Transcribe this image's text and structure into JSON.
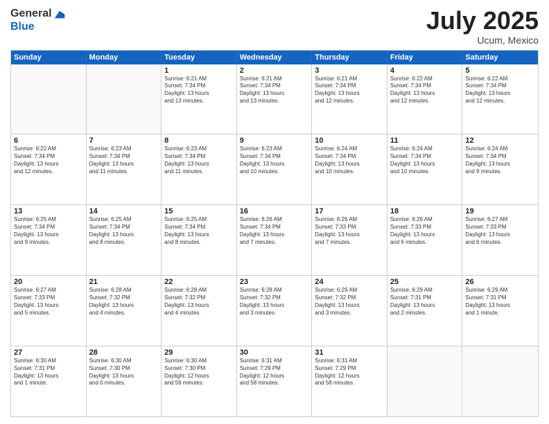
{
  "logo": {
    "general": "General",
    "blue": "Blue"
  },
  "title": "July 2025",
  "location": "Ucum, Mexico",
  "header_days": [
    "Sunday",
    "Monday",
    "Tuesday",
    "Wednesday",
    "Thursday",
    "Friday",
    "Saturday"
  ],
  "weeks": [
    [
      {
        "day": "",
        "text": ""
      },
      {
        "day": "",
        "text": ""
      },
      {
        "day": "1",
        "text": "Sunrise: 6:21 AM\nSunset: 7:34 PM\nDaylight: 13 hours\nand 13 minutes."
      },
      {
        "day": "2",
        "text": "Sunrise: 6:21 AM\nSunset: 7:34 PM\nDaylight: 13 hours\nand 13 minutes."
      },
      {
        "day": "3",
        "text": "Sunrise: 6:21 AM\nSunset: 7:34 PM\nDaylight: 13 hours\nand 12 minutes."
      },
      {
        "day": "4",
        "text": "Sunrise: 6:22 AM\nSunset: 7:34 PM\nDaylight: 13 hours\nand 12 minutes."
      },
      {
        "day": "5",
        "text": "Sunrise: 6:22 AM\nSunset: 7:34 PM\nDaylight: 13 hours\nand 12 minutes."
      }
    ],
    [
      {
        "day": "6",
        "text": "Sunrise: 6:22 AM\nSunset: 7:34 PM\nDaylight: 13 hours\nand 12 minutes."
      },
      {
        "day": "7",
        "text": "Sunrise: 6:23 AM\nSunset: 7:34 PM\nDaylight: 13 hours\nand 11 minutes."
      },
      {
        "day": "8",
        "text": "Sunrise: 6:23 AM\nSunset: 7:34 PM\nDaylight: 13 hours\nand 11 minutes."
      },
      {
        "day": "9",
        "text": "Sunrise: 6:23 AM\nSunset: 7:34 PM\nDaylight: 13 hours\nand 10 minutes."
      },
      {
        "day": "10",
        "text": "Sunrise: 6:24 AM\nSunset: 7:34 PM\nDaylight: 13 hours\nand 10 minutes."
      },
      {
        "day": "11",
        "text": "Sunrise: 6:24 AM\nSunset: 7:34 PM\nDaylight: 13 hours\nand 10 minutes."
      },
      {
        "day": "12",
        "text": "Sunrise: 6:24 AM\nSunset: 7:34 PM\nDaylight: 13 hours\nand 9 minutes."
      }
    ],
    [
      {
        "day": "13",
        "text": "Sunrise: 6:25 AM\nSunset: 7:34 PM\nDaylight: 13 hours\nand 9 minutes."
      },
      {
        "day": "14",
        "text": "Sunrise: 6:25 AM\nSunset: 7:34 PM\nDaylight: 13 hours\nand 8 minutes."
      },
      {
        "day": "15",
        "text": "Sunrise: 6:25 AM\nSunset: 7:34 PM\nDaylight: 13 hours\nand 8 minutes."
      },
      {
        "day": "16",
        "text": "Sunrise: 6:26 AM\nSunset: 7:34 PM\nDaylight: 13 hours\nand 7 minutes."
      },
      {
        "day": "17",
        "text": "Sunrise: 6:26 AM\nSunset: 7:33 PM\nDaylight: 13 hours\nand 7 minutes."
      },
      {
        "day": "18",
        "text": "Sunrise: 6:26 AM\nSunset: 7:33 PM\nDaylight: 13 hours\nand 6 minutes."
      },
      {
        "day": "19",
        "text": "Sunrise: 6:27 AM\nSunset: 7:33 PM\nDaylight: 13 hours\nand 6 minutes."
      }
    ],
    [
      {
        "day": "20",
        "text": "Sunrise: 6:27 AM\nSunset: 7:33 PM\nDaylight: 13 hours\nand 5 minutes."
      },
      {
        "day": "21",
        "text": "Sunrise: 6:28 AM\nSunset: 7:32 PM\nDaylight: 13 hours\nand 4 minutes."
      },
      {
        "day": "22",
        "text": "Sunrise: 6:28 AM\nSunset: 7:32 PM\nDaylight: 13 hours\nand 4 minutes."
      },
      {
        "day": "23",
        "text": "Sunrise: 6:28 AM\nSunset: 7:32 PM\nDaylight: 13 hours\nand 3 minutes."
      },
      {
        "day": "24",
        "text": "Sunrise: 6:29 AM\nSunset: 7:32 PM\nDaylight: 13 hours\nand 3 minutes."
      },
      {
        "day": "25",
        "text": "Sunrise: 6:29 AM\nSunset: 7:31 PM\nDaylight: 13 hours\nand 2 minutes."
      },
      {
        "day": "26",
        "text": "Sunrise: 6:29 AM\nSunset: 7:31 PM\nDaylight: 13 hours\nand 1 minute."
      }
    ],
    [
      {
        "day": "27",
        "text": "Sunrise: 6:30 AM\nSunset: 7:31 PM\nDaylight: 13 hours\nand 1 minute."
      },
      {
        "day": "28",
        "text": "Sunrise: 6:30 AM\nSunset: 7:30 PM\nDaylight: 13 hours\nand 0 minutes."
      },
      {
        "day": "29",
        "text": "Sunrise: 6:30 AM\nSunset: 7:30 PM\nDaylight: 12 hours\nand 59 minutes."
      },
      {
        "day": "30",
        "text": "Sunrise: 6:31 AM\nSunset: 7:29 PM\nDaylight: 12 hours\nand 58 minutes."
      },
      {
        "day": "31",
        "text": "Sunrise: 6:31 AM\nSunset: 7:29 PM\nDaylight: 12 hours\nand 58 minutes."
      },
      {
        "day": "",
        "text": ""
      },
      {
        "day": "",
        "text": ""
      }
    ]
  ]
}
